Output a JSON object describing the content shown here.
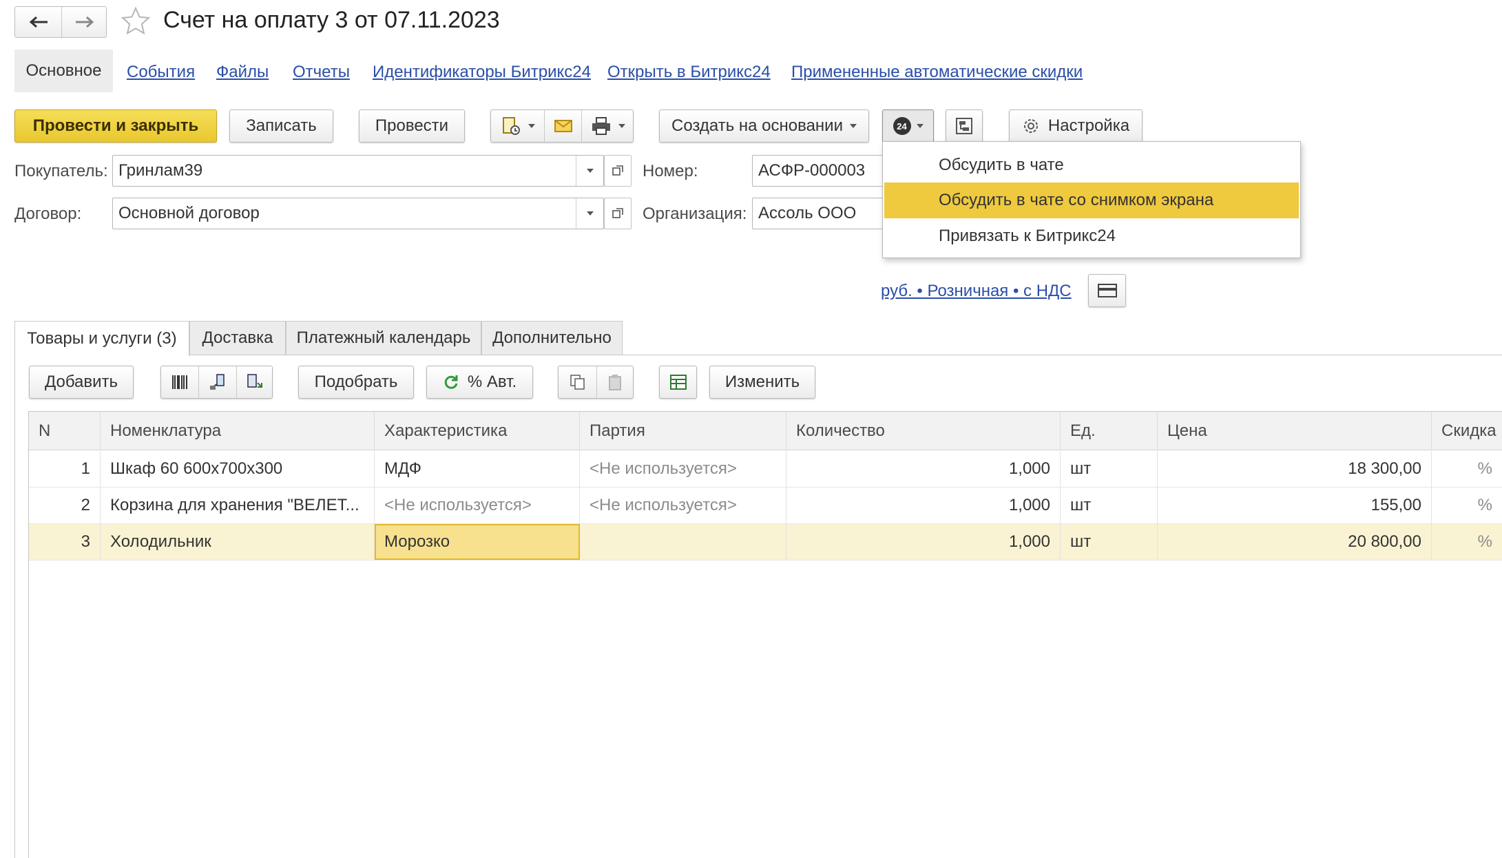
{
  "window": {
    "title": "Счет на оплату 3 от 07.11.2023",
    "back_icon": "arrow-left-icon",
    "forward_icon": "arrow-right-icon",
    "favorite_icon": "star-icon"
  },
  "nav": {
    "active": "Основное",
    "links": [
      "События",
      "Файлы",
      "Отчеты",
      "Идентификаторы Битрикс24",
      "Открыть в Битрикс24",
      "Примененные автоматические скидки"
    ]
  },
  "toolbar": {
    "post_close": "Провести и закрыть",
    "save": "Записать",
    "post": "Провести",
    "create_based": "Создать на основании",
    "settings": "Настройка",
    "b24_badge": "24"
  },
  "form": {
    "buyer_label": "Покупатель:",
    "buyer_value": "Гринлам39",
    "contract_label": "Договор:",
    "contract_value": "Основной договор",
    "number_label": "Номер:",
    "number_value": "АСФР-000003",
    "org_label": "Организация:",
    "org_value": "Ассоль ООО",
    "price_link": "руб. • Розничная • с НДС"
  },
  "dropdown": {
    "items": [
      {
        "label": "Обсудить в  чате",
        "highlighted": false
      },
      {
        "label": "Обсудить в  чате  со снимком экрана",
        "highlighted": true
      },
      {
        "label": "Привязать к Битрикс24",
        "highlighted": false
      }
    ]
  },
  "tabs": [
    "Товары и услуги (3)",
    "Доставка",
    "Платежный календарь",
    "Дополнительно"
  ],
  "table_toolbar": {
    "add": "Добавить",
    "pick": "Подобрать",
    "auto_discount": "% Авт.",
    "change": "Изменить"
  },
  "table": {
    "columns": [
      "N",
      "Номенклатура",
      "Характеристика",
      "Партия",
      "Количество",
      "Ед.",
      "Цена",
      "Скидка"
    ],
    "rows": [
      {
        "n": "1",
        "name": "Шкаф 60 600х700х300",
        "char": "МДФ",
        "batch": "<Не используется>",
        "qty": "1,000",
        "unit": "шт",
        "price": "18 300,00",
        "discount": "%"
      },
      {
        "n": "2",
        "name": "Корзина для хранения \"ВЕЛЕТ...",
        "char": "<Не используется>",
        "batch": "<Не используется>",
        "qty": "1,000",
        "unit": "шт",
        "price": "155,00",
        "discount": "%"
      },
      {
        "n": "3",
        "name": "Холодильник",
        "char": "Морозко",
        "batch": "",
        "qty": "1,000",
        "unit": "шт",
        "price": "20 800,00",
        "discount": "%"
      }
    ]
  },
  "colors": {
    "accent_yellow": "#efc93e",
    "link_blue": "#2a4ea8",
    "selected_row": "#faf3d3"
  }
}
